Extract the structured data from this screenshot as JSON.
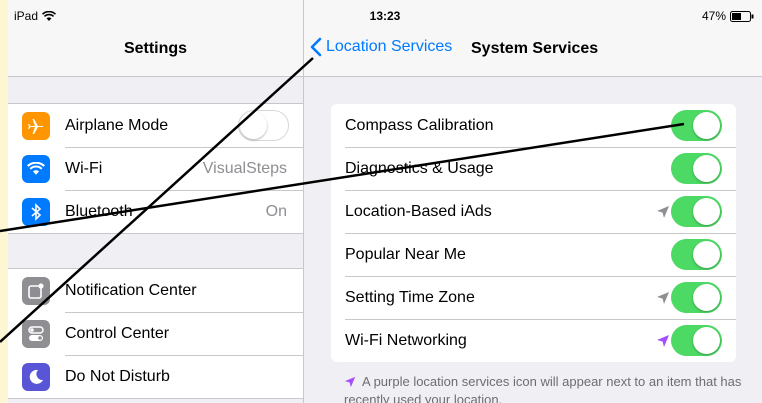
{
  "status_bar": {
    "device": "iPad",
    "time": "13:23",
    "battery": "47%"
  },
  "settings_pane": {
    "title": "Settings",
    "group1": [
      {
        "label": "Airplane Mode",
        "icon": "airplane-icon",
        "color": "#ff9500",
        "toggle": "off"
      },
      {
        "label": "Wi-Fi",
        "icon": "wifi-icon",
        "color": "#007aff",
        "value": "VisualSteps"
      },
      {
        "label": "Bluetooth",
        "icon": "bluetooth-icon",
        "color": "#007aff",
        "value": "On"
      }
    ],
    "group2": [
      {
        "label": "Notification Center",
        "icon": "notification-center-icon",
        "color": "#8e8e93"
      },
      {
        "label": "Control Center",
        "icon": "control-center-icon",
        "color": "#8e8e93"
      },
      {
        "label": "Do Not Disturb",
        "icon": "moon-icon",
        "color": "#5856d6"
      }
    ]
  },
  "system_services": {
    "back_label": "Location Services",
    "title": "System Services",
    "rows": [
      {
        "label": "Compass Calibration",
        "toggle": "on",
        "arrow": "none"
      },
      {
        "label": "Diagnostics & Usage",
        "toggle": "on",
        "arrow": "none"
      },
      {
        "label": "Location-Based iAds",
        "toggle": "on",
        "arrow": "gray"
      },
      {
        "label": "Popular Near Me",
        "toggle": "on",
        "arrow": "none"
      },
      {
        "label": "Setting Time Zone",
        "toggle": "on",
        "arrow": "gray"
      },
      {
        "label": "Wi-Fi Networking",
        "toggle": "on",
        "arrow": "purple"
      }
    ],
    "footnote": "A purple location services icon will appear next to an item that has recently used your location."
  },
  "colors": {
    "accent": "#007aff",
    "toggle_on": "#4cd964",
    "arrow_gray": "#8e8e93",
    "arrow_purple": "#a64dff"
  }
}
